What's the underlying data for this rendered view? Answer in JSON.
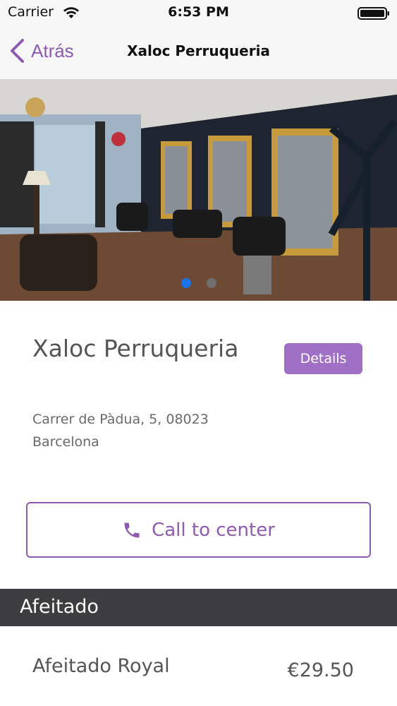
{
  "status_bar": {
    "carrier": "Carrier",
    "time": "6:53 PM",
    "icons": [
      "wifi-icon",
      "battery-icon"
    ]
  },
  "nav": {
    "back_label": "Atrás",
    "title": "Xaloc Perruqueria",
    "back_icon": "chevron-left-icon"
  },
  "hero": {
    "page_count": 2,
    "active_page": 1
  },
  "salon": {
    "name": "Xaloc Perruqueria",
    "details_label": "Details",
    "address": "Carrer de Pàdua, 5, 08023 Barcelona"
  },
  "call": {
    "label": "Call to center",
    "icon": "phone-icon"
  },
  "section": {
    "title": "Afeitado"
  },
  "services": [
    {
      "name": "Afeitado Royal",
      "price": "€29.50"
    }
  ],
  "colors": {
    "accent": "#8d5bb3",
    "details_bg": "#a070c6",
    "section_bg": "#3d3d3f",
    "active_dot": "#1a73e8"
  }
}
